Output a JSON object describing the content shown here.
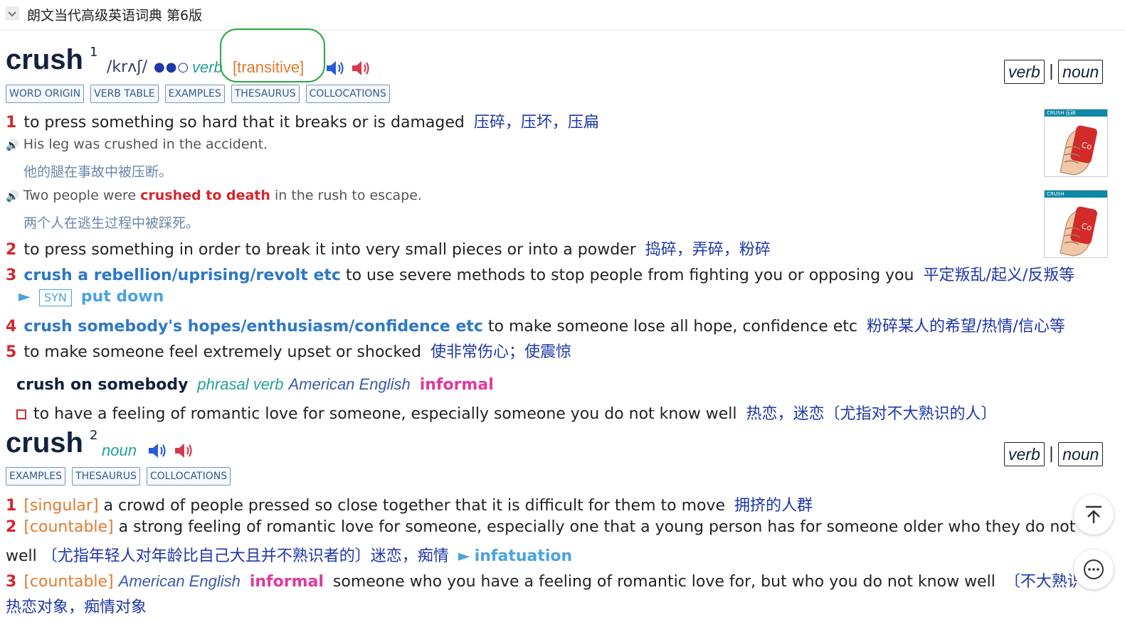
{
  "header": {
    "title": "朗文当代高级英语词典 第6版"
  },
  "pos_switch": {
    "verb": "verb",
    "noun": "noun",
    "sep": "|"
  },
  "entry1": {
    "headword": "crush",
    "homnum": "1",
    "pron": "/krʌʃ/",
    "freq": "●●○",
    "pos": "verb",
    "grammar": "[transitive]",
    "tabs": [
      "WORD ORIGIN",
      "VERB TABLE",
      "EXAMPLES",
      "THESAURUS",
      "COLLOCATIONS"
    ],
    "sense1": {
      "num": "1",
      "def": "to press something so hard that it breaks or is damaged",
      "cn": "压碎，压坏，压扁",
      "ex1": {
        "en": "His leg was crushed in the accident.",
        "cn": "他的腿在事故中被压断。"
      },
      "ex2": {
        "pre": "Two people were",
        "coll": "crushed to death",
        "post": "in the rush to escape.",
        "cn": "两个人在逃生过程中被踩死。"
      }
    },
    "sense2": {
      "num": "2",
      "def": "to press something in order to break it into very small pieces or into a powder",
      "cn": "捣碎，弄碎，粉碎"
    },
    "sense3": {
      "num": "3",
      "lex": "crush a rebellion/uprising/revolt etc",
      "def": "to use severe methods to stop people from fighting you or opposing you",
      "cn": "平定叛乱/起义/反叛等",
      "syn_tag": "SYN",
      "syn": "put down"
    },
    "sense4": {
      "num": "4",
      "lex": "crush somebody's hopes/enthusiasm/confidence etc",
      "def": "to make someone lose all hope, confidence etc",
      "cn": "粉碎某人的希望/热情/信心等"
    },
    "sense5": {
      "num": "5",
      "def": "to make someone feel extremely upset or shocked",
      "cn": "使非常伤心；使震惊"
    },
    "phrasal": {
      "phrase": "crush on somebody",
      "pos": "phrasal verb",
      "region": "American English",
      "register": "informal",
      "def": "to have a feeling of romantic love for someone, especially someone you do not know well",
      "cn": "热恋，迷恋〔尤指对不大熟识的人〕"
    },
    "images": {
      "img1_label": "CRUSH 压碎",
      "img2_label": "CRUSH"
    }
  },
  "entry2": {
    "headword": "crush",
    "homnum": "2",
    "pos": "noun",
    "tabs": [
      "EXAMPLES",
      "THESAURUS",
      "COLLOCATIONS"
    ],
    "sense1": {
      "num": "1",
      "label": "[singular]",
      "def": "a crowd of people pressed so close together that it is difficult for them to move",
      "cn": "拥挤的人群"
    },
    "sense2": {
      "num": "2",
      "label": "[countable]",
      "def": "a strong feeling of romantic love for someone, especially one that a young person has for someone older who they do not kno",
      "def_cont": "well",
      "cn": "〔尤指年轻人对年龄比自己大且并不熟识者的〕迷恋，痴情",
      "syn": "infatuation"
    },
    "sense3": {
      "num": "3",
      "label": "[countable]",
      "region": "American English",
      "register": "informal",
      "def": "someone who you have a feeling of romantic love for, but who you do not know well",
      "cn": "〔不大熟识的",
      "cn_cont": "热恋对象，痴情对象"
    }
  },
  "icons": [
    "chevron-down-icon",
    "speaker-uk-icon",
    "speaker-us-icon",
    "example-audio-icon",
    "back-to-top-icon",
    "more-icon"
  ],
  "colors": {
    "headword": "#14213d",
    "sense_number": "#d6262d",
    "chinese": "#1d36a8",
    "pos": "#23a095",
    "grammar": "#e07a2f",
    "register": "#e0399b",
    "synonym": "#4aa3df"
  }
}
